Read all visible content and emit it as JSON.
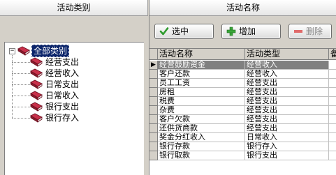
{
  "left_panel": {
    "header": "活动类别",
    "tree": {
      "root_label": "全部类别",
      "expander": "−",
      "children": [
        "经营支出",
        "经营收入",
        "日常支出",
        "日常收入",
        "银行支出",
        "银行存入"
      ]
    }
  },
  "right_panel": {
    "header": "活动名称",
    "toolbar": {
      "select_label": "选中",
      "add_label": "增加",
      "delete_label": "删除"
    },
    "grid": {
      "columns": [
        "活动名称",
        "活动类型",
        "备"
      ],
      "indicator": "▶",
      "rows": [
        [
          "经营鼓励资金",
          "经营收入"
        ],
        [
          "客户还款",
          "经营收入"
        ],
        [
          "员工工资",
          "经营支出"
        ],
        [
          "房租",
          "经营支出"
        ],
        [
          "税费",
          "经营支出"
        ],
        [
          "杂费",
          "经营支出"
        ],
        [
          "客户欠款",
          "经营支出"
        ],
        [
          "还供货商款",
          "经营支出"
        ],
        [
          "奖金分红收入",
          "日常收入"
        ],
        [
          "银行存款",
          "银行存入"
        ],
        [
          "银行取款",
          "银行支出"
        ]
      ],
      "selected_row": 0
    }
  },
  "colors": {
    "panel_bg": "#d4d0c8",
    "selection_tree": "#0a246a",
    "selection_grid": "#808080",
    "check_green": "#2e9b2e",
    "add_green": "#3aa63a",
    "delete_red": "#e06a6a",
    "folder_red": "#c8304a"
  },
  "icons": {
    "select": "check-icon",
    "add": "plus-icon",
    "delete": "minus-icon",
    "folder": "folder-icon"
  }
}
